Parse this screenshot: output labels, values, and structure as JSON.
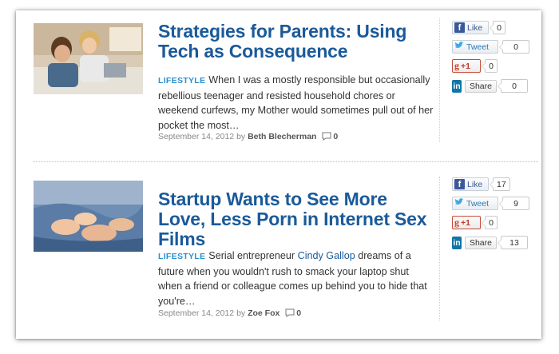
{
  "articles": [
    {
      "title": "Strategies for Parents: Using Tech as Consequence",
      "category": "LIFESTYLE",
      "excerpt": "When I was a mostly responsible but occasionally rebellious teenager and resisted household chores or weekend curfews, my Mother would sometimes pull out of her pocket the most…",
      "date": "September 14, 2012",
      "by": "by",
      "author": "Beth Blecherman",
      "comments": "0",
      "social": {
        "like_label": "Like",
        "like_count": "0",
        "tweet_label": "Tweet",
        "tweet_count": "0",
        "plus_label": "+1",
        "plus_count": "0",
        "share_label": "Share",
        "share_count": "0"
      }
    },
    {
      "title": "Startup Wants to See More Love, Less Porn in Internet Sex Films",
      "category": "LIFESTYLE",
      "excerpt_before": "Serial entrepreneur",
      "excerpt_link": "Cindy Gallop",
      "excerpt_after": "dreams of a future when you wouldn't rush to smack your laptop shut when a friend or colleague comes up behind you to hide that you're…",
      "date": "September 14, 2012",
      "by": "by",
      "author": "Zoe Fox",
      "comments": "0",
      "social": {
        "like_label": "Like",
        "like_count": "17",
        "tweet_label": "Tweet",
        "tweet_count": "9",
        "plus_label": "+1",
        "plus_count": "0",
        "share_label": "Share",
        "share_count": "13"
      }
    }
  ],
  "icons": {
    "fb": "facebook-icon",
    "tw": "twitter-icon",
    "gp": "google-plus-icon",
    "li": "linkedin-icon",
    "comment": "comment-bubble-icon"
  },
  "colors": {
    "title": "#1a5a9a",
    "category": "#2a8fd0",
    "facebook": "#3b5998",
    "linkedin": "#0e76a8",
    "google": "#d0402e"
  }
}
